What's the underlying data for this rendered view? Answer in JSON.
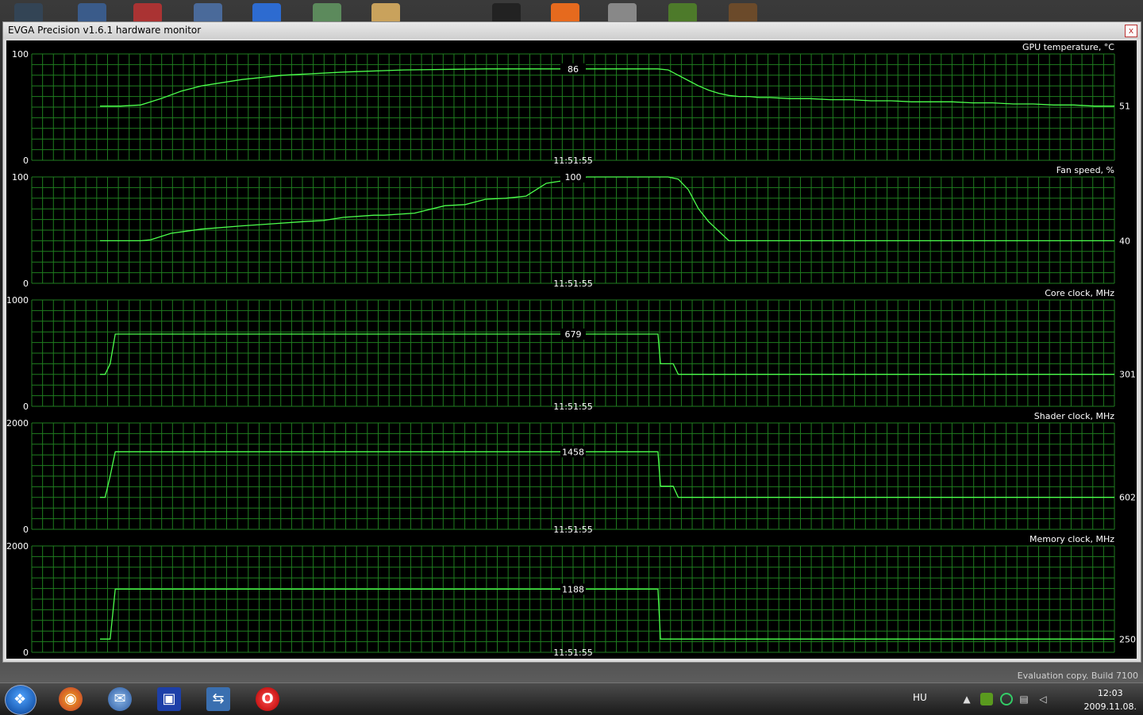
{
  "window": {
    "title": "EVGA Precision v1.6.1 hardware monitor",
    "close_glyph": "x"
  },
  "colors": {
    "grid": "#1f7d1f",
    "line": "#4cff4c",
    "text": "#ffffff",
    "background": "#000000"
  },
  "icons": {
    "close": "close-icon",
    "start": "windows-start-icon",
    "firefox": "firefox-icon",
    "thunderbird": "thunderbird-icon",
    "save": "floppy-disk-icon",
    "network": "network-tool-icon",
    "opera": "opera-icon",
    "tray_arrow": "show-hidden-icons-icon",
    "tray_nvidia": "nvidia-icon",
    "tray_circle": "status-circle-icon",
    "tray_network": "network-icon",
    "tray_volume": "volume-icon"
  },
  "chart_data": [
    {
      "type": "line",
      "title": "GPU temperature, °C",
      "ylim": [
        0,
        100
      ],
      "y_top_label": "100",
      "y_bottom_label": "0",
      "time_label": "11:51:55",
      "marker_value": "86",
      "current_value": "51",
      "x": [
        0,
        4,
        8,
        12,
        16,
        20,
        28,
        36,
        48,
        60,
        76,
        92,
        100,
        104,
        106,
        108,
        110,
        112,
        114,
        116,
        118,
        120,
        122,
        124,
        126,
        128,
        130,
        132,
        136,
        140,
        144,
        148,
        152,
        156,
        160,
        164,
        168,
        172,
        176,
        180,
        184,
        188,
        192,
        196,
        200
      ],
      "values": [
        51,
        51,
        52,
        58,
        65,
        70,
        76,
        80,
        83,
        85,
        86,
        86,
        86,
        86,
        86,
        86,
        86,
        85,
        80,
        75,
        70,
        66,
        63,
        61,
        60,
        60,
        59,
        59,
        58,
        58,
        57,
        57,
        56,
        56,
        55,
        55,
        55,
        54,
        54,
        53,
        53,
        52,
        52,
        51,
        51
      ]
    },
    {
      "type": "line",
      "title": "Fan speed, %",
      "ylim": [
        0,
        100
      ],
      "y_top_label": "100",
      "y_bottom_label": "0",
      "time_label": "11:51:55",
      "marker_value": "100",
      "current_value": "40",
      "x": [
        0,
        8,
        10,
        14,
        20,
        28,
        34,
        40,
        44,
        48,
        54,
        56,
        62,
        68,
        72,
        76,
        80,
        84,
        88,
        96,
        100,
        104,
        106,
        108,
        110,
        112,
        114,
        116,
        118,
        120,
        124,
        130,
        140,
        160,
        180,
        200
      ],
      "values": [
        40,
        40,
        41,
        47,
        51,
        54,
        56,
        58,
        59,
        62,
        64,
        64,
        66,
        73,
        74,
        79,
        80,
        82,
        94,
        100,
        100,
        100,
        100,
        100,
        100,
        100,
        98,
        88,
        70,
        58,
        40,
        40,
        40,
        40,
        40,
        40
      ]
    },
    {
      "type": "line",
      "title": "Core clock, MHz",
      "ylim": [
        0,
        1000
      ],
      "y_top_label": "1000",
      "y_bottom_label": "0",
      "time_label": "11:51:55",
      "marker_value": "679",
      "current_value": "301",
      "x": [
        0,
        1,
        2,
        3,
        4,
        6,
        10,
        20,
        40,
        60,
        80,
        100,
        108,
        110,
        110.5,
        112,
        113,
        114,
        114.5,
        116,
        120,
        140,
        160,
        180,
        200
      ],
      "values": [
        301,
        301,
        400,
        679,
        679,
        679,
        679,
        679,
        679,
        679,
        679,
        679,
        679,
        679,
        400,
        400,
        400,
        301,
        301,
        301,
        301,
        301,
        301,
        301,
        301
      ]
    },
    {
      "type": "line",
      "title": "Shader clock, MHz",
      "ylim": [
        0,
        2000
      ],
      "y_top_label": "2000",
      "y_bottom_label": "0",
      "time_label": "11:51:55",
      "marker_value": "1458",
      "current_value": "602",
      "x": [
        0,
        1,
        2,
        3,
        4,
        6,
        10,
        20,
        40,
        60,
        80,
        100,
        108,
        110,
        110.5,
        112,
        113,
        114,
        114.5,
        116,
        120,
        140,
        160,
        180,
        200
      ],
      "values": [
        602,
        602,
        1000,
        1458,
        1458,
        1458,
        1458,
        1458,
        1458,
        1458,
        1458,
        1458,
        1458,
        1458,
        810,
        810,
        810,
        602,
        602,
        602,
        602,
        602,
        602,
        602,
        602
      ]
    },
    {
      "type": "line",
      "title": "Memory clock, MHz",
      "ylim": [
        0,
        2000
      ],
      "y_top_label": "2000",
      "y_bottom_label": "0",
      "time_label": "11:51:55",
      "marker_value": "1188",
      "current_value": "250",
      "x": [
        0,
        1,
        2,
        3,
        4,
        6,
        10,
        20,
        40,
        60,
        80,
        100,
        108,
        110,
        110.5,
        112,
        116,
        120,
        140,
        160,
        180,
        200
      ],
      "values": [
        250,
        250,
        250,
        1188,
        1188,
        1188,
        1188,
        1188,
        1188,
        1188,
        1188,
        1188,
        1188,
        1188,
        250,
        250,
        250,
        250,
        250,
        250,
        250,
        250
      ]
    }
  ],
  "taskbar": {
    "language": "HU",
    "time": "12:03",
    "date": "2009.11.08.",
    "watermark": "Evaluation copy. Build 7100",
    "apps": [
      {
        "name": "firefox",
        "glyph": "◉"
      },
      {
        "name": "thunderbird",
        "glyph": "✉"
      },
      {
        "name": "save",
        "glyph": "▣"
      },
      {
        "name": "network",
        "glyph": "⇆"
      },
      {
        "name": "opera",
        "glyph": "O"
      }
    ]
  }
}
